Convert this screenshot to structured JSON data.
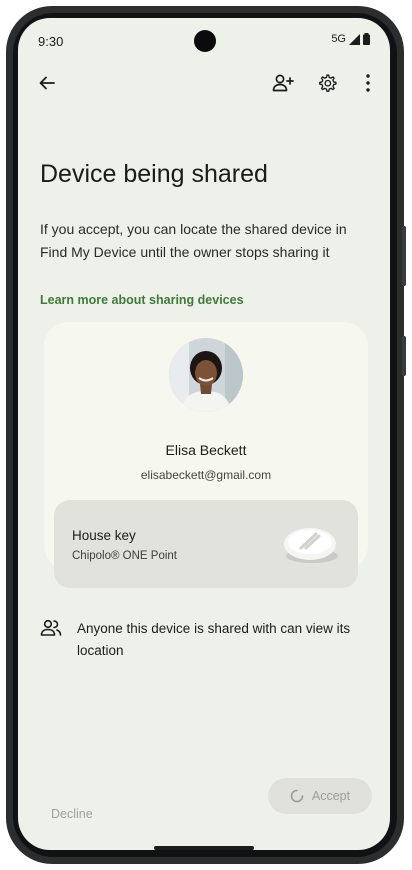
{
  "status_bar": {
    "time": "9:30",
    "network": "5G"
  },
  "app_bar": {
    "back_icon": "arrow-left",
    "add_person_icon": "person-add",
    "settings_icon": "gear",
    "more_icon": "more-vert"
  },
  "page": {
    "title": "Device being shared",
    "description": "If you accept, you can locate the shared device in Find My Device until the owner stops sharing it",
    "learn_more": "Learn more about sharing devices"
  },
  "owner": {
    "name": "Elisa Beckett",
    "email": "elisabeckett@gmail.com"
  },
  "device": {
    "name": "House key",
    "model": "Chipolo® ONE Point"
  },
  "notice": {
    "icon": "people",
    "text": "Anyone this device is shared with can view its location"
  },
  "actions": {
    "decline_label": "Decline",
    "accept_label": "Accept"
  },
  "colors": {
    "background": "#eef0ea",
    "card": "#f6f7ef",
    "link": "#3f7a3a",
    "disabled_text": "#9fa29b"
  }
}
